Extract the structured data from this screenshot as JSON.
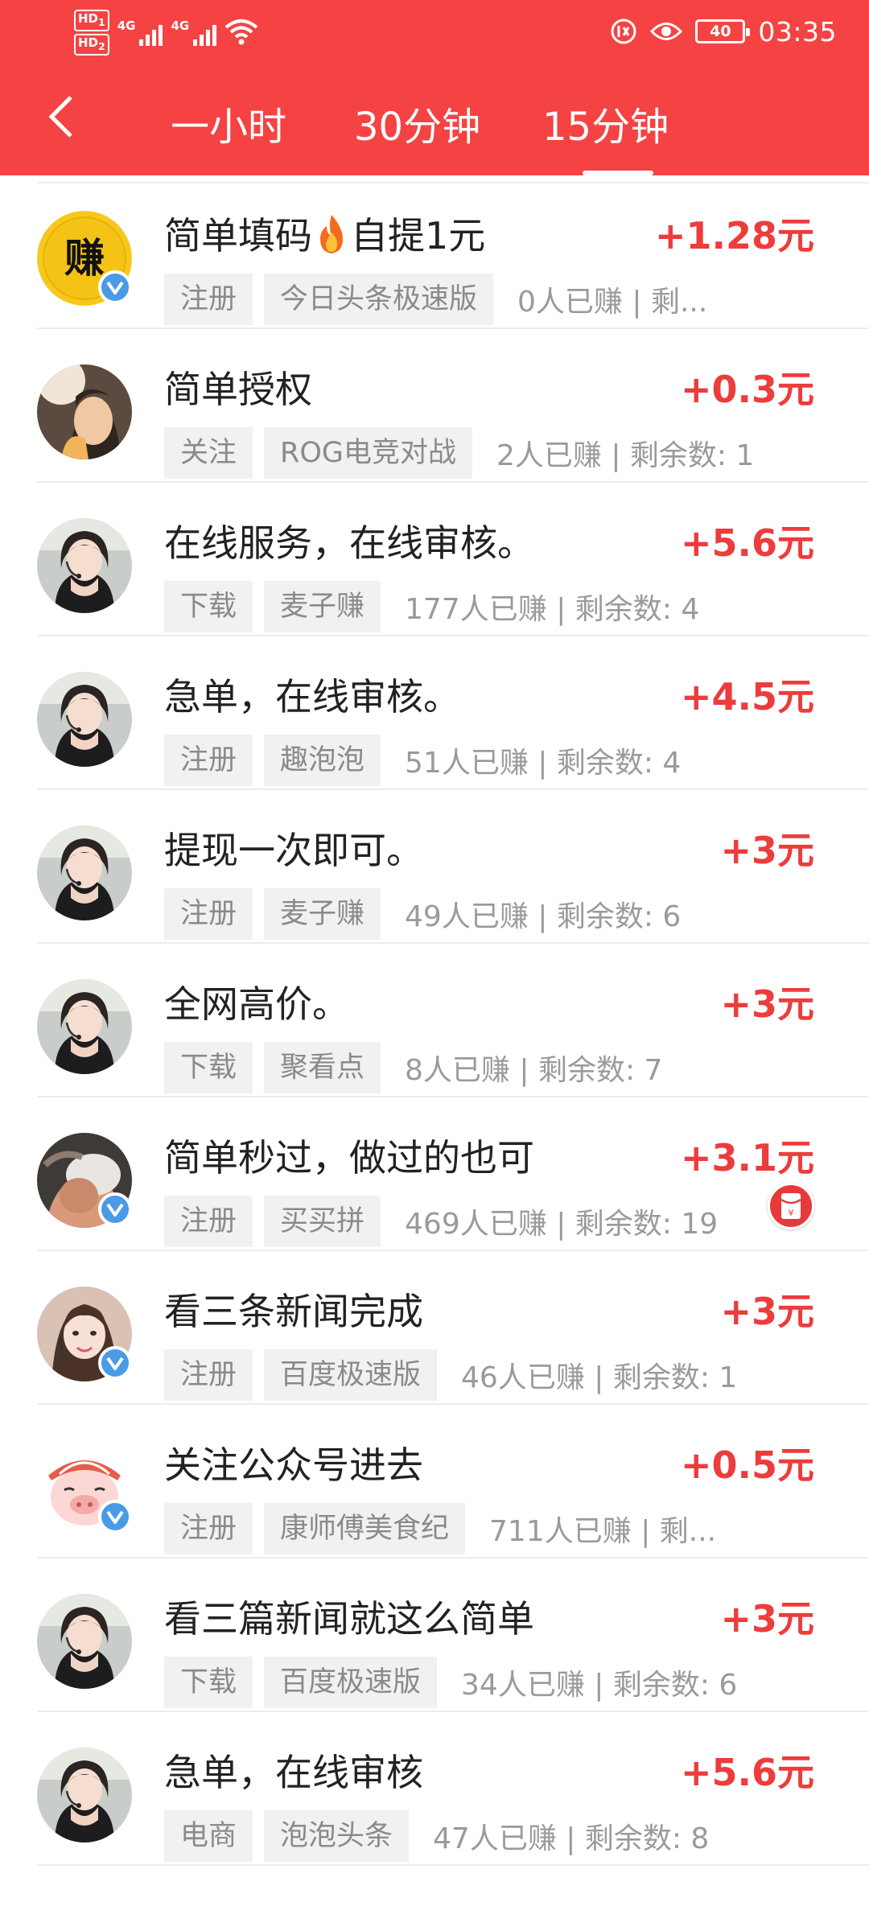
{
  "status_bar": {
    "hd1": "HD",
    "hd1_sub": "1",
    "hd2": "HD",
    "hd2_sub": "2",
    "sim1": "4G",
    "sim2": "4G",
    "battery": "40",
    "time": "03:35"
  },
  "nav": {
    "tabs": [
      {
        "label": "一小时",
        "active": false
      },
      {
        "label": "30分钟",
        "active": false
      },
      {
        "label": "15分钟",
        "active": true
      }
    ]
  },
  "tasks": [
    {
      "title_a": "简单填码",
      "title_b": "自提1元",
      "reward": "+1.28元",
      "type": "注册",
      "app": "今日头条极速版",
      "stats": "0人已赚 | 剩...",
      "avatar": "zhuan-logo-avatar",
      "avatar_text": "赚",
      "verified": true
    },
    {
      "title": "简单授权",
      "reward": "+0.3元",
      "type": "关注",
      "app": "ROG电竞对战",
      "stats": "2人已赚 | 剩余数: 1",
      "avatar": "girl-photo-avatar",
      "verified": false
    },
    {
      "title": "在线服务，在线审核。",
      "reward": "+5.6元",
      "type": "下载",
      "app": "麦子赚",
      "stats": "177人已赚 | 剩余数: 4",
      "avatar": "headset-girl-avatar",
      "verified": false
    },
    {
      "title": "急单，在线审核。",
      "reward": "+4.5元",
      "type": "注册",
      "app": "趣泡泡",
      "stats": "51人已赚 | 剩余数: 4",
      "avatar": "headset-girl-avatar",
      "verified": false
    },
    {
      "title": "提现一次即可。",
      "reward": "+3元",
      "type": "注册",
      "app": "麦子赚",
      "stats": "49人已赚 | 剩余数: 6",
      "avatar": "headset-girl-avatar",
      "verified": false
    },
    {
      "title": "全网高价。",
      "reward": "+3元",
      "type": "下载",
      "app": "聚看点",
      "stats": "8人已赚 | 剩余数: 7",
      "avatar": "headset-girl-avatar",
      "verified": false
    },
    {
      "title": "简单秒过，做过的也可",
      "reward": "+3.1元",
      "type": "注册",
      "app": "买买拼",
      "stats": "469人已赚 | 剩余数: 19",
      "avatar": "man-photo-avatar",
      "verified": true
    },
    {
      "title": "看三条新闻完成",
      "reward": "+3元",
      "type": "注册",
      "app": "百度极速版",
      "stats": "46人已赚 | 剩余数: 1",
      "avatar": "smiling-girl-avatar",
      "verified": true
    },
    {
      "title": "关注公众号进去",
      "reward": "+0.5元",
      "type": "注册",
      "app": "康师傅美食纪",
      "stats": "711人已赚 | 剩...",
      "avatar": "cartoon-pig-avatar",
      "verified": true
    },
    {
      "title": "看三篇新闻就这么简单",
      "reward": "+3元",
      "type": "下载",
      "app": "百度极速版",
      "stats": "34人已赚 | 剩余数: 6",
      "avatar": "headset-girl-avatar",
      "verified": false
    },
    {
      "title": "急单，在线审核",
      "reward": "+5.6元",
      "type": "电商",
      "app": "泡泡头条",
      "stats": "47人已赚 | 剩余数: 8",
      "avatar": "headset-girl-avatar",
      "verified": false
    }
  ],
  "floating": {
    "red_packet_icon": "red-packet-icon",
    "red_packet_glyph": "¥"
  },
  "colors": {
    "header": "#f54343",
    "reward": "#ed3c3c",
    "tag_bg": "#f1f1f1",
    "verified_badge": "#4a9be6"
  }
}
